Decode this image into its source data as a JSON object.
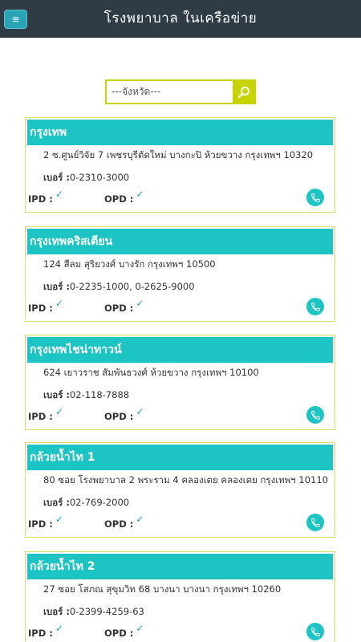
{
  "header": {
    "title": "โรงพยาบาล ในเครือข่าย",
    "menu_icon": "hamburger-icon",
    "menu_glyph": "≡"
  },
  "search": {
    "placeholder": "---จังหวัด---",
    "icon": "search-icon"
  },
  "labels": {
    "phone": "เบอร์ :",
    "ipd": "IPD :",
    "opd": "OPD :",
    "check": "✓"
  },
  "colors": {
    "topbar": "#2f3b45",
    "accent": "#1cc4c4",
    "search_border": "#c8d400",
    "card_border": "#d9dc6b"
  },
  "hospitals": [
    {
      "name": "กรุงเทพ",
      "address": "2 ซ.ศูนย์วิจัย 7 เพชรบุรีตัดใหม่ บางกะปิ ห้วยขวาง กรุงเทพฯ 10320",
      "phone": "0-2310-3000"
    },
    {
      "name": "กรุงเทพคริสเตียน",
      "address": "124 สีลม สุริยวงศ์ บางรัก กรุงเทพฯ 10500",
      "phone": "0-2235-1000, 0-2625-9000"
    },
    {
      "name": "กรุงเทพไชน่าทาวน์",
      "address": "624 เยาวราช สัมพันธวงศ์ ห้วยขวาง กรุงเทพฯ 10100",
      "phone": "02-118-7888"
    },
    {
      "name": "กล้วยน้ำไท 1",
      "address": "80 ซอย โรงพยาบาล 2 พระราม 4 คลองเตย คลองเตย กรุงเทพฯ 10110",
      "phone": "02-769-2000"
    },
    {
      "name": "กล้วยน้ำไท 2",
      "address": "27 ซอย โสภณ สุขุมวิท 68 บางนา บางนา กรุงเทพฯ 10260",
      "phone": "0-2399-4259-63"
    }
  ]
}
